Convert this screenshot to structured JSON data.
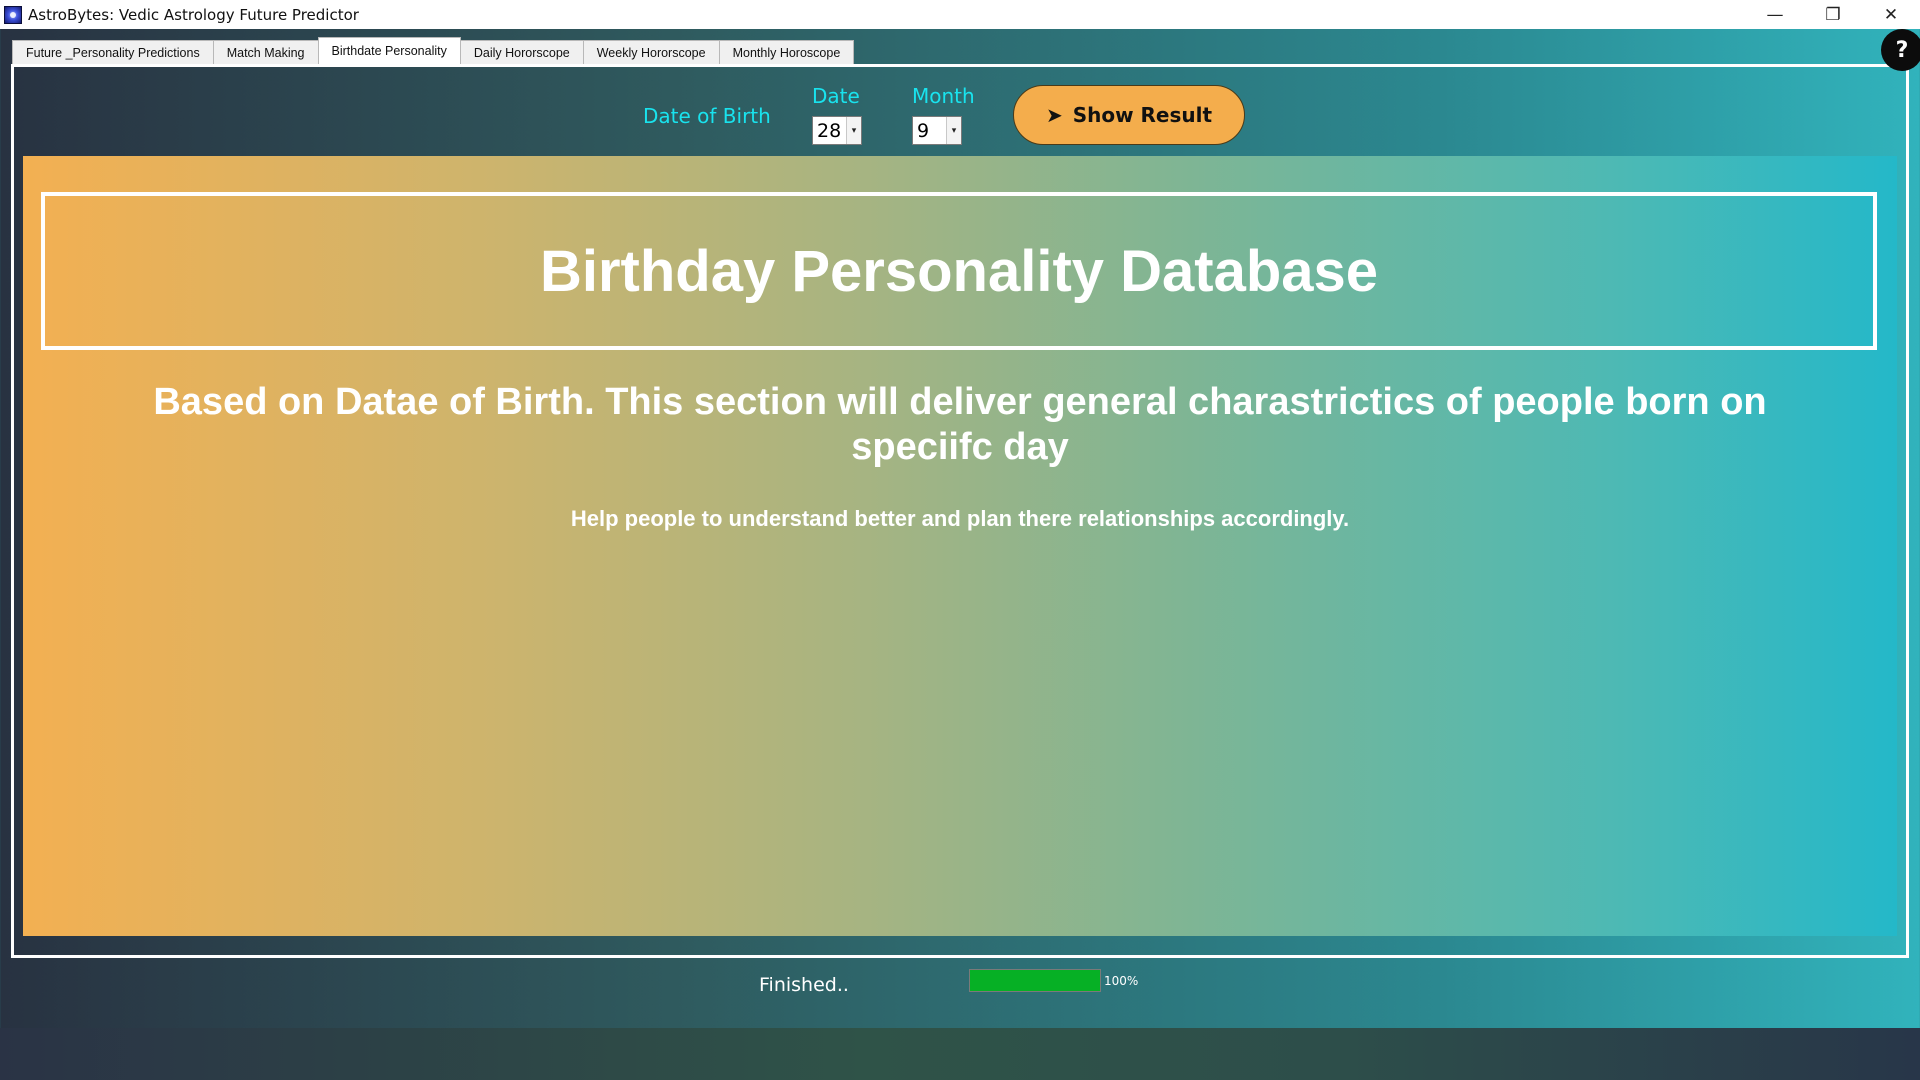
{
  "window": {
    "title": "AstroBytes: Vedic Astrology Future Predictor",
    "controls": {
      "minimize": "—",
      "restore": "❐",
      "close": "✕"
    }
  },
  "tabs": [
    {
      "label": "Future _Personality Predictions",
      "active": false
    },
    {
      "label": "Match Making",
      "active": false
    },
    {
      "label": "Birthdate Personality",
      "active": true
    },
    {
      "label": "Daily Hororscope",
      "active": false
    },
    {
      "label": "Weekly Hororscope",
      "active": false
    },
    {
      "label": "Monthly Horoscope",
      "active": false
    }
  ],
  "help": {
    "label": "?"
  },
  "form": {
    "dob_label": "Date of Birth",
    "date_label": "Date",
    "date_value": "28",
    "month_label": "Month",
    "month_value": "9",
    "show_result_label": "Show Result",
    "show_result_icon": "➤"
  },
  "content": {
    "heading": "Birthday Personality Database",
    "subtitle": "Based on Datae of Birth. This section will deliver general charastrictics of people born on speciifc day",
    "note": "Help people to understand better and plan there relationships accordingly."
  },
  "status": {
    "text": "Finished..",
    "progress_percent": 100,
    "progress_label": "100%"
  },
  "colors": {
    "accent_cyan": "#19e3ee",
    "button_orange": "#f4ad4c",
    "progress_green": "#06b025"
  }
}
